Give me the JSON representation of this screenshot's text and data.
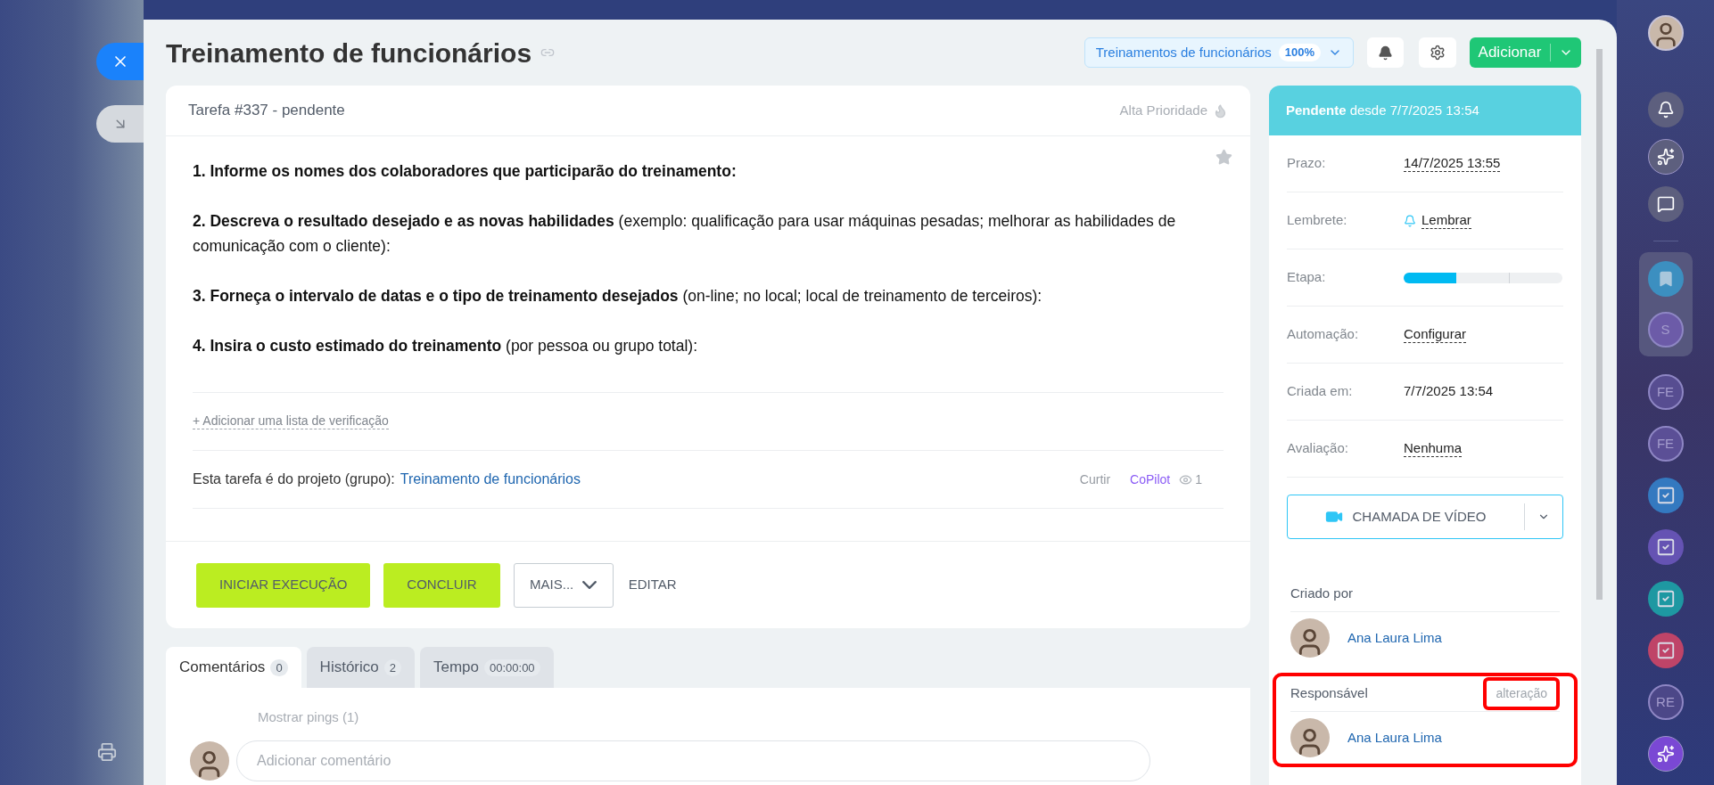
{
  "header": {
    "title": "Treinamento de funcionários",
    "project_pill": {
      "label": "Treinamentos de funcionários",
      "badge": "100%"
    },
    "add_button": "Adicionar"
  },
  "task": {
    "heading": "Tarefa #337 - pendente",
    "priority": "Alta Prioridade",
    "description": [
      {
        "text": "1. Informe os nomes dos colaboradores que participarão do treinamento:",
        "bold": true
      },
      {
        "text": "**2. Descreva o resultado desejado e as novas habilidades** (exemplo: qualificação para usar máquinas pesadas; melhorar as habilidades de comunicação com o cliente):",
        "bold": false
      },
      {
        "text": "**3. Forneça o intervalo de datas e o tipo de treinamento desejados** (on-line; no local; local de treinamento de terceiros):",
        "bold": false
      },
      {
        "text": "**4. Insira o custo estimado do treinamento** (por pessoa ou grupo total):",
        "bold": false
      }
    ],
    "checklist_link": "+ Adicionar uma lista de verificação",
    "project_line": {
      "label": "Esta tarefa é do projeto (grupo):",
      "link": "Treinamento de funcionários"
    },
    "actions": {
      "like": "Curtir",
      "copilot": "CoPilot",
      "views": "1"
    },
    "buttons": [
      {
        "label": "INICIAR EXECUÇÃO",
        "kind": "primary"
      },
      {
        "label": "CONCLUIR",
        "kind": "primary"
      },
      {
        "label": "MAIS...",
        "kind": "dropdown"
      },
      {
        "label": "EDITAR",
        "kind": "link"
      }
    ]
  },
  "tabs": [
    {
      "label": "Comentários",
      "count": "0",
      "selected": true
    },
    {
      "label": "Histórico",
      "count": "2",
      "selected": false
    },
    {
      "label": "Tempo",
      "count": "00:00:00",
      "selected": false
    }
  ],
  "comments": {
    "pings": "Mostrar pings (1)",
    "placeholder": "Adicionar comentário"
  },
  "sidebar": {
    "status": "**Pendente** desde 7/7/2025 13:54",
    "fields": [
      {
        "label": "Prazo:",
        "value": "14/7/2025 13:55",
        "kind": "link"
      },
      {
        "label": "Lembrete:",
        "value": "Lembrar",
        "kind": "reminder"
      },
      {
        "label": "Etapa:",
        "kind": "progress",
        "level": 0.33
      },
      {
        "label": "Automação:",
        "value": "Configurar",
        "kind": "link"
      },
      {
        "label": "Criada em:",
        "value": "7/7/2025 13:54",
        "kind": "text"
      },
      {
        "label": "Avaliação:",
        "value": "Nenhuma",
        "kind": "link"
      }
    ],
    "video_call": "CHAMADA DE VÍDEO",
    "people": [
      {
        "role": "Criado por",
        "name": "Ana Laura Lima",
        "highlighted": false
      },
      {
        "role": "Responsável",
        "action": "alteração",
        "name": "Ana Laura Lima",
        "highlighted": true
      }
    ]
  },
  "rail": {
    "top": [
      {
        "kind": "avatar"
      },
      {
        "kind": "bell"
      },
      {
        "kind": "copilot"
      },
      {
        "kind": "chat"
      }
    ],
    "pinned": [
      {
        "kind": "bookmark",
        "color": "#3c8fc0"
      },
      {
        "kind": "initials",
        "label": "S",
        "color": "#6c5ba8"
      }
    ],
    "items": [
      {
        "kind": "initials",
        "label": "FE",
        "color": "#574d91"
      },
      {
        "kind": "initials",
        "label": "FE",
        "color": "#5b4f96"
      },
      {
        "kind": "task",
        "color": "#3479c0"
      },
      {
        "kind": "task",
        "color": "#6553b3"
      },
      {
        "kind": "task",
        "color": "#1e98a2"
      },
      {
        "kind": "task",
        "color": "#bf4468"
      },
      {
        "kind": "initials",
        "label": "RE",
        "color": "#4c4788"
      },
      {
        "kind": "copilot",
        "color": "#7a48d4"
      }
    ]
  }
}
